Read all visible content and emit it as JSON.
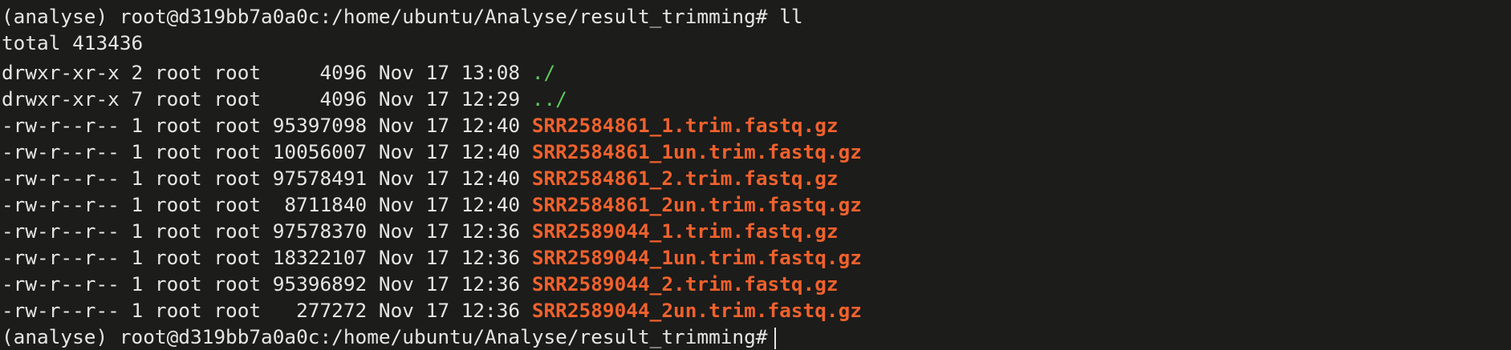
{
  "terminal": {
    "prompt": "(analyse) root@d319bb7a0a0c:/home/ubuntu/Analyse/result_trimming#",
    "command": "ll",
    "total": "total 413436",
    "entries": [
      {
        "perms": "drwxr-xr-x",
        "links": "2",
        "owner": "root",
        "group": "root",
        "size": "4096",
        "date": "Nov 17 13:08",
        "name": "./",
        "kind": "dir"
      },
      {
        "perms": "drwxr-xr-x",
        "links": "7",
        "owner": "root",
        "group": "root",
        "size": "4096",
        "date": "Nov 17 12:29",
        "name": "../",
        "kind": "dir"
      },
      {
        "perms": "-rw-r--r--",
        "links": "1",
        "owner": "root",
        "group": "root",
        "size": "95397098",
        "date": "Nov 17 12:40",
        "name": "SRR2584861_1.trim.fastq.gz",
        "kind": "gz"
      },
      {
        "perms": "-rw-r--r--",
        "links": "1",
        "owner": "root",
        "group": "root",
        "size": "10056007",
        "date": "Nov 17 12:40",
        "name": "SRR2584861_1un.trim.fastq.gz",
        "kind": "gz"
      },
      {
        "perms": "-rw-r--r--",
        "links": "1",
        "owner": "root",
        "group": "root",
        "size": "97578491",
        "date": "Nov 17 12:40",
        "name": "SRR2584861_2.trim.fastq.gz",
        "kind": "gz"
      },
      {
        "perms": "-rw-r--r--",
        "links": "1",
        "owner": "root",
        "group": "root",
        "size": "8711840",
        "date": "Nov 17 12:40",
        "name": "SRR2584861_2un.trim.fastq.gz",
        "kind": "gz"
      },
      {
        "perms": "-rw-r--r--",
        "links": "1",
        "owner": "root",
        "group": "root",
        "size": "97578370",
        "date": "Nov 17 12:36",
        "name": "SRR2589044_1.trim.fastq.gz",
        "kind": "gz"
      },
      {
        "perms": "-rw-r--r--",
        "links": "1",
        "owner": "root",
        "group": "root",
        "size": "18322107",
        "date": "Nov 17 12:36",
        "name": "SRR2589044_1un.trim.fastq.gz",
        "kind": "gz"
      },
      {
        "perms": "-rw-r--r--",
        "links": "1",
        "owner": "root",
        "group": "root",
        "size": "95396892",
        "date": "Nov 17 12:36",
        "name": "SRR2589044_2.trim.fastq.gz",
        "kind": "gz"
      },
      {
        "perms": "-rw-r--r--",
        "links": "1",
        "owner": "root",
        "group": "root",
        "size": "277272",
        "date": "Nov 17 12:36",
        "name": "SRR2589044_2un.trim.fastq.gz",
        "kind": "gz"
      }
    ]
  },
  "colors": {
    "background": "#1c1c1a",
    "text": "#e6e6e6",
    "directory": "#5fc95f",
    "archive": "#f0612d"
  }
}
